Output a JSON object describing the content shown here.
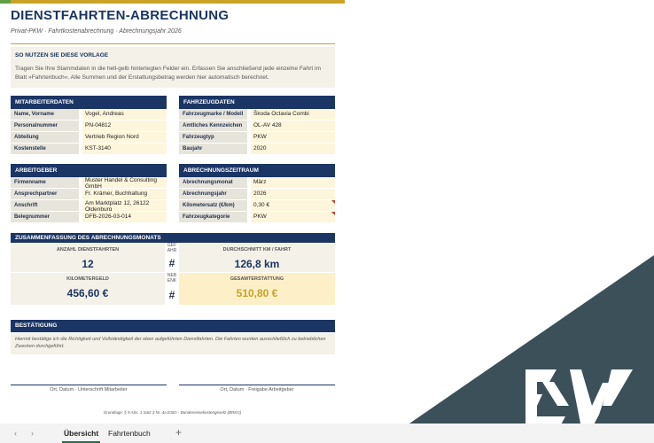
{
  "doc": {
    "title": "DIENSTFAHRTEN-ABRECHNUNG",
    "subtitle": "Privat-PKW  ·  Fahrtkostenabrechnung  ·  Abrechnungsjahr 2026"
  },
  "info": {
    "heading": "SO NUTZEN SIE DIESE VORLAGE",
    "text": "Tragen Sie Ihre Stammdaten in die hell-gelb hinterlegten Felder ein. Erfassen Sie anschließend jede einzelne Fahrt im Blatt »Fahrtenbuch«. Alle Summen und der Erstattungsbetrag werden hier automatisch berechnet."
  },
  "employee": {
    "heading": "MITARBEITERDATEN",
    "rows": [
      {
        "label": "Name, Vorname",
        "value": "Vogel, Andreas"
      },
      {
        "label": "Personalnummer",
        "value": "PN-04812"
      },
      {
        "label": "Abteilung",
        "value": "Vertrieb Region Nord"
      },
      {
        "label": "Kostenstelle",
        "value": "KST-3140"
      }
    ]
  },
  "vehicle": {
    "heading": "FAHRZEUGDATEN",
    "rows": [
      {
        "label": "Fahrzeugmarke / Modell",
        "value": "Škoda Octavia Combi"
      },
      {
        "label": "Amtliches Kennzeichen",
        "value": "OL-AV 428"
      },
      {
        "label": "Fahrzeugtyp",
        "value": "PKW"
      },
      {
        "label": "Baujahr",
        "value": "2020"
      }
    ]
  },
  "employer": {
    "heading": "ARBEITGEBER",
    "rows": [
      {
        "label": "Firmenname",
        "value": "Muster Handel & Consulting GmbH"
      },
      {
        "label": "Ansprechpartner",
        "value": "Fr. Krämer, Buchhaltung"
      },
      {
        "label": "Anschrift",
        "value": "Am Marktplatz 12, 26122 Oldenburg"
      },
      {
        "label": "Belegnummer",
        "value": "DFB-2026-03-014"
      }
    ]
  },
  "period": {
    "heading": "ABRECHNUNGSZEITRAUM",
    "rows": [
      {
        "label": "Abrechnungsmonat",
        "value": "März"
      },
      {
        "label": "Abrechnungsjahr",
        "value": "2026"
      },
      {
        "label": "Kilometersatz (€/km)",
        "value": "0,30 €"
      },
      {
        "label": "Fahrzeugkategorie",
        "value": "PKW"
      }
    ]
  },
  "summary": {
    "heading": "ZUSAMMENFASSUNG DES ABRECHNUNGSMONATS",
    "trips_label": "ANZAHL DIENSTFAHRTEN",
    "trips_value": "12",
    "avg_label": "DURCHSCHNITT KM / FAHRT",
    "avg_value": "126,8 km",
    "kmgeld_label": "KILOMETERGELD",
    "kmgeld_value": "456,60 €",
    "total_label": "GESAMTERSTATTUNG",
    "total_value": "510,80 €",
    "mid_top": "GEF AHR",
    "mid_bottom": "NEB ENK",
    "hash": "#"
  },
  "confirm": {
    "heading": "BESTÄTIGUNG",
    "text": "Hiermit bestätige ich die Richtigkeit und Vollständigkeit der oben aufgeführten Dienstfahrten. Die Fahrten wurden ausschließlich zu betrieblichen Zwecken durchgeführt.",
    "sig_left": "Ort, Datum · Unterschrift Mitarbeiter",
    "sig_right": "Ort, Datum · Freigabe Arbeitgeber"
  },
  "footer": "Grundlage: § 9 Abs. 1 Satz 3 Nr. 4a EStG · Bundesreisekostengesetz (BRKG)",
  "tabs": {
    "prev": "‹",
    "next": "›",
    "items": [
      "Übersicht",
      "Fahrtenbuch"
    ],
    "add": "+"
  },
  "colors": {
    "navy": "#1b3564",
    "gold": "#c9a227",
    "corner": "#3b5058"
  }
}
